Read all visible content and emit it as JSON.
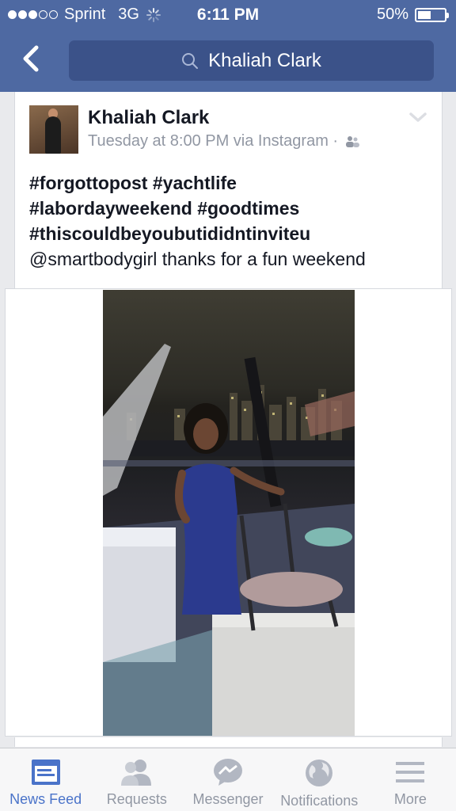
{
  "status_bar": {
    "carrier": "Sprint",
    "network": "3G",
    "time": "6:11 PM",
    "battery_text": "50%",
    "battery_level": 0.5,
    "signal_bars_filled": 3,
    "signal_bars_total": 5
  },
  "nav": {
    "search_value": "Khaliah Clark",
    "back_icon": "chevron-left-icon",
    "search_icon": "search-icon"
  },
  "post": {
    "author": "Khaliah Clark",
    "meta": "Tuesday at 8:00 PM via Instagram ·",
    "hashtags": [
      "#forgottopost",
      "#yachtlife",
      "#labordayweekend",
      "#goodtimes",
      "#thiscouldbeyoubutididntinviteu"
    ],
    "hashtag_lines": [
      [
        "#forgottopost",
        "#yachtlife"
      ],
      [
        "#labordayweekend",
        "#goodtimes"
      ],
      [
        "#thiscouldbeyoubutididntinviteu"
      ]
    ],
    "mention_line": "@smartbodygirl thanks for a fun weekend"
  },
  "tabs": [
    {
      "label": "News Feed",
      "icon": "news-feed-icon",
      "active": true
    },
    {
      "label": "Requests",
      "icon": "friend-requests-icon",
      "active": false
    },
    {
      "label": "Messenger",
      "icon": "messenger-icon",
      "active": false
    },
    {
      "label": "Notifications",
      "icon": "globe-icon",
      "active": false
    },
    {
      "label": "More",
      "icon": "menu-icon",
      "active": false
    }
  ],
  "colors": {
    "brand": "#4e69a2",
    "search_bg": "#3b5289",
    "active_tab": "#4a73c9",
    "muted": "#9197a3"
  }
}
